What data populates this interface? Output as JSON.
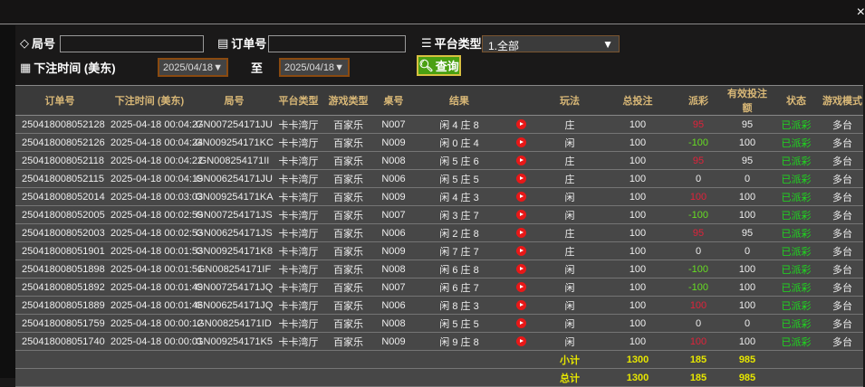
{
  "filters": {
    "round_label": "局号",
    "round_value": "",
    "order_label": "订单号",
    "order_value": "",
    "platform_label": "平台类型",
    "platform_value": "1.全部",
    "time_label": "下注时间 (美东)",
    "date_from": "2025/04/18",
    "to_label": "至",
    "date_to": "2025/04/18",
    "query_label": "查询"
  },
  "close_label": "×",
  "columns": [
    "订单号",
    "下注时间 (美东)",
    "局号",
    "平台类型",
    "游戏类型",
    "桌号",
    "结果",
    "",
    "玩法",
    "总投注",
    "派彩",
    "有效投注额",
    "状态",
    "游戏模式"
  ],
  "rows": [
    [
      "250418008052128",
      "2025-04-18 00:04:27",
      "GN007254171JU",
      "卡卡湾厅",
      "百家乐",
      "N007",
      "闲 4 庄 8",
      "庄",
      "100",
      "95",
      "95",
      "已派彩",
      "多台"
    ],
    [
      "250418008052126",
      "2025-04-18 00:04:24",
      "GN009254171KC",
      "卡卡湾厅",
      "百家乐",
      "N009",
      "闲 0 庄 4",
      "闲",
      "100",
      "-100",
      "100",
      "已派彩",
      "多台"
    ],
    [
      "250418008052118",
      "2025-04-18 00:04:22",
      "GN008254171II",
      "卡卡湾厅",
      "百家乐",
      "N008",
      "闲 5 庄 6",
      "庄",
      "100",
      "95",
      "95",
      "已派彩",
      "多台"
    ],
    [
      "250418008052115",
      "2025-04-18 00:04:19",
      "GN006254171JU",
      "卡卡湾厅",
      "百家乐",
      "N006",
      "闲 5 庄 5",
      "庄",
      "100",
      "0",
      "0",
      "已派彩",
      "多台"
    ],
    [
      "250418008052014",
      "2025-04-18 00:03:03",
      "GN009254171KA",
      "卡卡湾厅",
      "百家乐",
      "N009",
      "闲 4 庄 3",
      "闲",
      "100",
      "100",
      "100",
      "已派彩",
      "多台"
    ],
    [
      "250418008052005",
      "2025-04-18 00:02:59",
      "GN007254171JS",
      "卡卡湾厅",
      "百家乐",
      "N007",
      "闲 3 庄 7",
      "闲",
      "100",
      "-100",
      "100",
      "已派彩",
      "多台"
    ],
    [
      "250418008052003",
      "2025-04-18 00:02:53",
      "GN006254171JS",
      "卡卡湾厅",
      "百家乐",
      "N006",
      "闲 2 庄 8",
      "庄",
      "100",
      "95",
      "95",
      "已派彩",
      "多台"
    ],
    [
      "250418008051901",
      "2025-04-18 00:01:53",
      "GN009254171K8",
      "卡卡湾厅",
      "百家乐",
      "N009",
      "闲 7 庄 7",
      "庄",
      "100",
      "0",
      "0",
      "已派彩",
      "多台"
    ],
    [
      "250418008051898",
      "2025-04-18 00:01:51",
      "GN008254171IF",
      "卡卡湾厅",
      "百家乐",
      "N008",
      "闲 6 庄 8",
      "闲",
      "100",
      "-100",
      "100",
      "已派彩",
      "多台"
    ],
    [
      "250418008051892",
      "2025-04-18 00:01:49",
      "GN007254171JQ",
      "卡卡湾厅",
      "百家乐",
      "N007",
      "闲 6 庄 7",
      "闲",
      "100",
      "-100",
      "100",
      "已派彩",
      "多台"
    ],
    [
      "250418008051889",
      "2025-04-18 00:01:46",
      "GN006254171JQ",
      "卡卡湾厅",
      "百家乐",
      "N006",
      "闲 8 庄 3",
      "闲",
      "100",
      "100",
      "100",
      "已派彩",
      "多台"
    ],
    [
      "250418008051759",
      "2025-04-18 00:00:12",
      "GN008254171ID",
      "卡卡湾厅",
      "百家乐",
      "N008",
      "闲 5 庄 5",
      "闲",
      "100",
      "0",
      "0",
      "已派彩",
      "多台"
    ],
    [
      "250418008051740",
      "2025-04-18 00:00:01",
      "GN009254171K5",
      "卡卡湾厅",
      "百家乐",
      "N009",
      "闲 9 庄 8",
      "闲",
      "100",
      "100",
      "100",
      "已派彩",
      "多台"
    ]
  ],
  "subtotal": {
    "label": "小计",
    "total_bet": "1300",
    "payout": "185",
    "valid_bet": "985"
  },
  "total": {
    "label": "总计",
    "total_bet": "1300",
    "payout": "185",
    "valid_bet": "985"
  },
  "colors": {
    "header_text": "#d9b877",
    "payout_positive": "#e0223a",
    "payout_negative": "#66dd22",
    "status": "#1ed81e",
    "totals": "#e6e600",
    "query_button": "#4aa012"
  }
}
